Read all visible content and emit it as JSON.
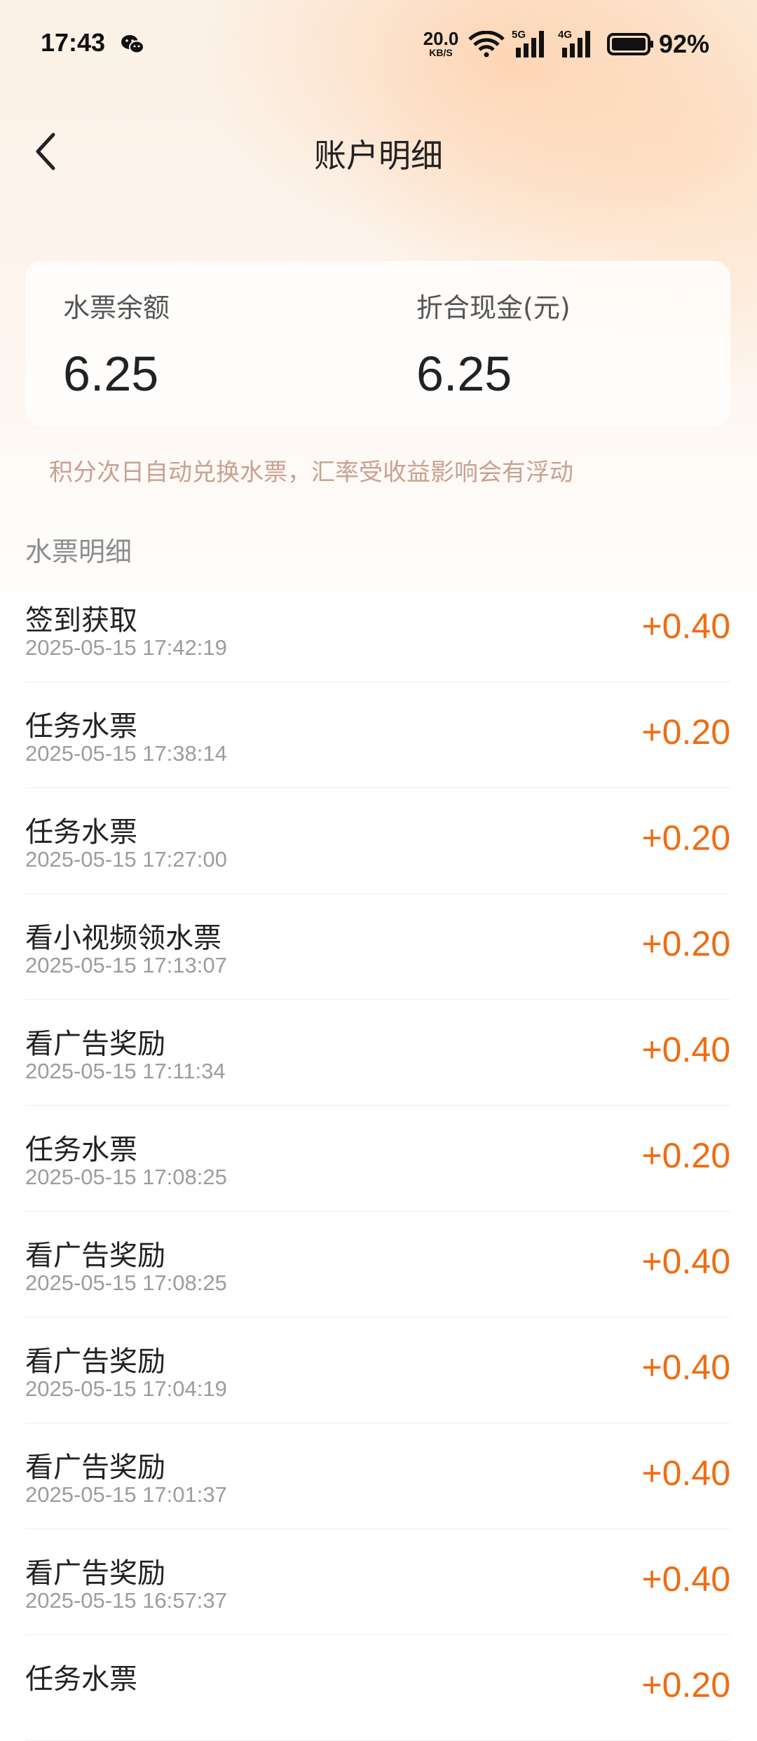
{
  "status_bar": {
    "time": "17:43",
    "net_speed_value": "20.0",
    "net_speed_unit": "KB/S",
    "signal1_label": "5G",
    "signal2_label": "4G",
    "battery_percent": "92%"
  },
  "header": {
    "title": "账户明细"
  },
  "balance_card": {
    "water_ticket_label": "水票余额",
    "water_ticket_value": "6.25",
    "cash_label": "折合现金(元)",
    "cash_value": "6.25"
  },
  "notice": "积分次日自动兑换水票，汇率受收益影响会有浮动",
  "section_title": "水票明细",
  "records": [
    {
      "name": "签到获取",
      "date": "2025-05-15 17:42:19",
      "amount": "+0.40"
    },
    {
      "name": "任务水票",
      "date": "2025-05-15 17:38:14",
      "amount": "+0.20"
    },
    {
      "name": "任务水票",
      "date": "2025-05-15 17:27:00",
      "amount": "+0.20"
    },
    {
      "name": "看小视频领水票",
      "date": "2025-05-15 17:13:07",
      "amount": "+0.20"
    },
    {
      "name": "看广告奖励",
      "date": "2025-05-15 17:11:34",
      "amount": "+0.40"
    },
    {
      "name": "任务水票",
      "date": "2025-05-15 17:08:25",
      "amount": "+0.20"
    },
    {
      "name": "看广告奖励",
      "date": "2025-05-15 17:08:25",
      "amount": "+0.40"
    },
    {
      "name": "看广告奖励",
      "date": "2025-05-15 17:04:19",
      "amount": "+0.40"
    },
    {
      "name": "看广告奖励",
      "date": "2025-05-15 17:01:37",
      "amount": "+0.40"
    },
    {
      "name": "看广告奖励",
      "date": "2025-05-15 16:57:37",
      "amount": "+0.40"
    },
    {
      "name": "任务水票",
      "date": "",
      "amount": "+0.20"
    }
  ],
  "colors": {
    "accent": "#ef6c12",
    "notice": "#c9a191"
  },
  "icons": {
    "back": "chevron-left-icon",
    "wechat": "wechat-icon",
    "wifi": "wifi-icon",
    "signal": "signal-bars-icon",
    "battery": "battery-icon"
  }
}
